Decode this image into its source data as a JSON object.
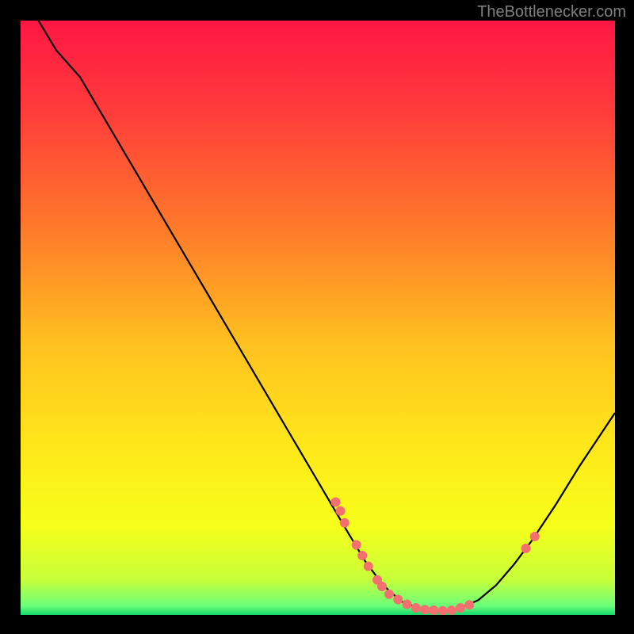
{
  "watermark": "TheBottlenecker.com",
  "chart_data": {
    "type": "line",
    "title": "",
    "xlabel": "",
    "ylabel": "",
    "xlim": [
      0,
      100
    ],
    "ylim": [
      0,
      100
    ],
    "background_gradient": {
      "stops": [
        {
          "offset": 0.0,
          "color": "#ff1744"
        },
        {
          "offset": 0.15,
          "color": "#ff3b3b"
        },
        {
          "offset": 0.35,
          "color": "#ff7a2a"
        },
        {
          "offset": 0.55,
          "color": "#ffc31f"
        },
        {
          "offset": 0.72,
          "color": "#ffe81a"
        },
        {
          "offset": 0.85,
          "color": "#f6ff1a"
        },
        {
          "offset": 0.94,
          "color": "#c8ff3a"
        },
        {
          "offset": 0.985,
          "color": "#6aff7a"
        },
        {
          "offset": 1.0,
          "color": "#12d66b"
        }
      ]
    },
    "curve": [
      {
        "x": 3.0,
        "y": 100.0
      },
      {
        "x": 6.0,
        "y": 95.0
      },
      {
        "x": 10.0,
        "y": 90.5
      },
      {
        "x": 15.0,
        "y": 82.0
      },
      {
        "x": 20.0,
        "y": 73.5
      },
      {
        "x": 25.0,
        "y": 65.0
      },
      {
        "x": 30.0,
        "y": 56.5
      },
      {
        "x": 35.0,
        "y": 48.0
      },
      {
        "x": 40.0,
        "y": 39.5
      },
      {
        "x": 45.0,
        "y": 31.0
      },
      {
        "x": 50.0,
        "y": 22.5
      },
      {
        "x": 55.0,
        "y": 14.0
      },
      {
        "x": 58.0,
        "y": 9.0
      },
      {
        "x": 61.0,
        "y": 5.0
      },
      {
        "x": 64.0,
        "y": 2.3
      },
      {
        "x": 67.5,
        "y": 1.0
      },
      {
        "x": 71.0,
        "y": 0.7
      },
      {
        "x": 74.0,
        "y": 1.2
      },
      {
        "x": 77.0,
        "y": 2.5
      },
      {
        "x": 80.0,
        "y": 5.0
      },
      {
        "x": 83.0,
        "y": 8.5
      },
      {
        "x": 86.0,
        "y": 12.5
      },
      {
        "x": 90.0,
        "y": 18.5
      },
      {
        "x": 94.0,
        "y": 25.0
      },
      {
        "x": 98.0,
        "y": 31.0
      },
      {
        "x": 100.0,
        "y": 34.0
      }
    ],
    "markers": [
      {
        "x": 53.0,
        "y": 19.0
      },
      {
        "x": 53.8,
        "y": 17.5
      },
      {
        "x": 54.5,
        "y": 15.5
      },
      {
        "x": 56.5,
        "y": 11.8
      },
      {
        "x": 57.5,
        "y": 10.0
      },
      {
        "x": 58.5,
        "y": 8.2
      },
      {
        "x": 60.0,
        "y": 5.9
      },
      {
        "x": 60.8,
        "y": 4.8
      },
      {
        "x": 62.0,
        "y": 3.5
      },
      {
        "x": 63.5,
        "y": 2.6
      },
      {
        "x": 65.0,
        "y": 1.8
      },
      {
        "x": 66.5,
        "y": 1.2
      },
      {
        "x": 68.0,
        "y": 0.9
      },
      {
        "x": 69.5,
        "y": 0.8
      },
      {
        "x": 71.0,
        "y": 0.7
      },
      {
        "x": 72.5,
        "y": 0.8
      },
      {
        "x": 74.0,
        "y": 1.2
      },
      {
        "x": 75.5,
        "y": 1.7
      },
      {
        "x": 85.0,
        "y": 11.2
      },
      {
        "x": 86.5,
        "y": 13.2
      }
    ],
    "marker_color": "#f47070",
    "curve_color": "#000000"
  }
}
